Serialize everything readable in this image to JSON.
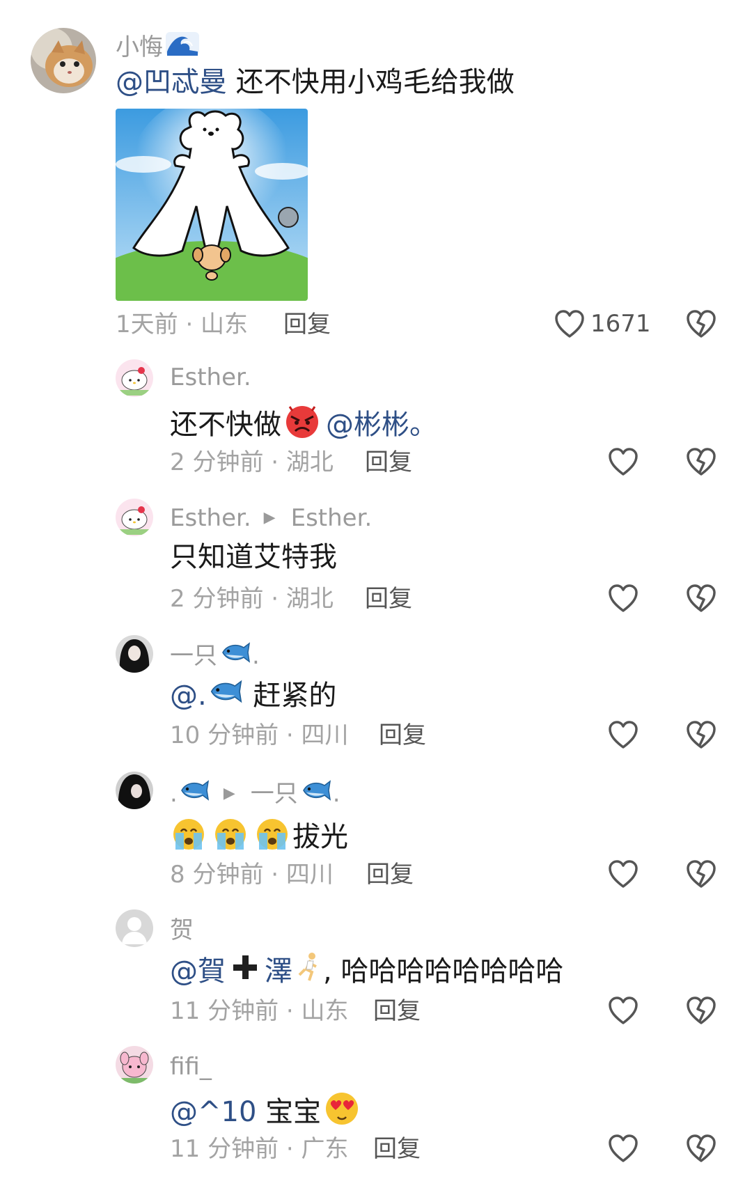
{
  "comments": [
    {
      "user": "小悔",
      "mention": "@凹忒曼",
      "text": " 还不快用小鸡毛给我做",
      "time_location": "1天前 · 山东",
      "reply_label": "回复",
      "likes": "1671"
    },
    {
      "user": "Esther.",
      "text_before": "还不快做",
      "mention": "@彬彬。",
      "time_location": "2 分钟前 · 湖北",
      "reply_label": "回复"
    },
    {
      "user": "Esther.",
      "reply_to": "Esther.",
      "text": "只知道艾特我",
      "time_location": "2 分钟前 · 湖北",
      "reply_label": "回复"
    },
    {
      "user": "一只",
      "user_suffix": ".",
      "mention": "@.",
      "text": " 赶紧的",
      "time_location": "10 分钟前 · 四川",
      "reply_label": "回复"
    },
    {
      "user": ".",
      "user_suffix": "",
      "reply_to": "一只",
      "reply_to_suffix": ".",
      "text": "拔光",
      "time_location": "8 分钟前 · 四川",
      "reply_label": "回复"
    },
    {
      "user": "贺",
      "mention_a": "@賀",
      "mention_b": "澤",
      "text": ", 哈哈哈哈哈哈哈哈",
      "time_location": "11 分钟前 · 山东",
      "reply_label": "回复"
    },
    {
      "user": "fifi_",
      "mention": "@^10",
      "text": " 宝宝",
      "time_location": "11 分钟前 · 广东",
      "reply_label": "回复"
    }
  ],
  "icons": {
    "like": "heart-outline-icon",
    "dislike": "broken-heart-icon",
    "fish": "fish-emoji",
    "angry": "angry-face-emoji",
    "crying": "crying-face-emoji",
    "heart_eyes": "heart-eyes-emoji",
    "wave": "wave-emoji",
    "runner": "runner-emoji",
    "plus": "heavy-plus-emoji"
  },
  "colors": {
    "mention": "#2e4f86",
    "meta": "#a3a3a3",
    "text": "#1a1a1a"
  }
}
